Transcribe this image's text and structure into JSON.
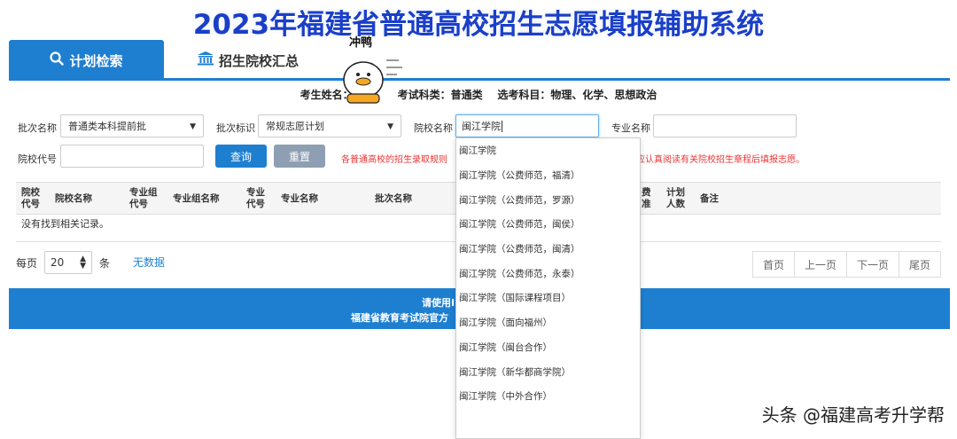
{
  "page_title": "2023年福建省普通高校招生志愿填报辅助系统",
  "tabs": [
    {
      "label": "计划检索",
      "active": true
    },
    {
      "label": "招生院校汇总",
      "active": false
    }
  ],
  "mascot_text": "冲鸭",
  "student_info": {
    "name_label": "考生姓名：",
    "subject_category_label": "考试科类：",
    "subject_category": "普通类",
    "elective_label": "选考科目：",
    "elective": "物理、化学、思想政治"
  },
  "filters": {
    "batch_label": "批次名称",
    "batch_value": "普通类本科提前批",
    "batch_flag_label": "批次标识",
    "batch_flag_value": "常规志愿计划",
    "school_name_label": "院校名称",
    "school_name_value": "闽江学院",
    "major_name_label": "专业名称",
    "major_name_value": "",
    "school_code_label": "院校代号",
    "school_code_value": ""
  },
  "buttons": {
    "query": "查询",
    "reset": "重置"
  },
  "notice": {
    "left": "各普通高校的招生录取规则",
    "right": "生应认真阅读有关院校招生章程后填报志愿。"
  },
  "table": {
    "headers": [
      "院校代号",
      "院校名称",
      "专业组代号",
      "专业组名称",
      "专业代号",
      "专业名称",
      "批次名称",
      "费准",
      "计划人数",
      "备注"
    ],
    "empty_text": "没有找到相关记录。"
  },
  "pagination": {
    "per_page_label": "每页",
    "per_page_value": "20",
    "per_page_unit": "条",
    "no_data": "无数据",
    "buttons": [
      "首页",
      "上一页",
      "下一页",
      "尾页"
    ]
  },
  "footer": {
    "line1": "请使用IE",
    "line2": "福建省教育考试院官方"
  },
  "suggestions": [
    "闽江学院",
    "闽江学院（公费师范，福清）",
    "闽江学院（公费师范，罗源）",
    "闽江学院（公费师范，闽侯）",
    "闽江学院（公费师范，闽清）",
    "闽江学院（公费师范，永泰）",
    "闽江学院（国际课程项目）",
    "闽江学院（面向福州）",
    "闽江学院（闽台合作）",
    "闽江学院（新华都商学院）",
    "闽江学院（中外合作）"
  ],
  "watermark": "头条 @福建高考升学帮",
  "colors": {
    "primary": "#1e7fd1",
    "title": "#1a3fc8",
    "notice": "#ee3333",
    "reset": "#8e9fb3"
  }
}
